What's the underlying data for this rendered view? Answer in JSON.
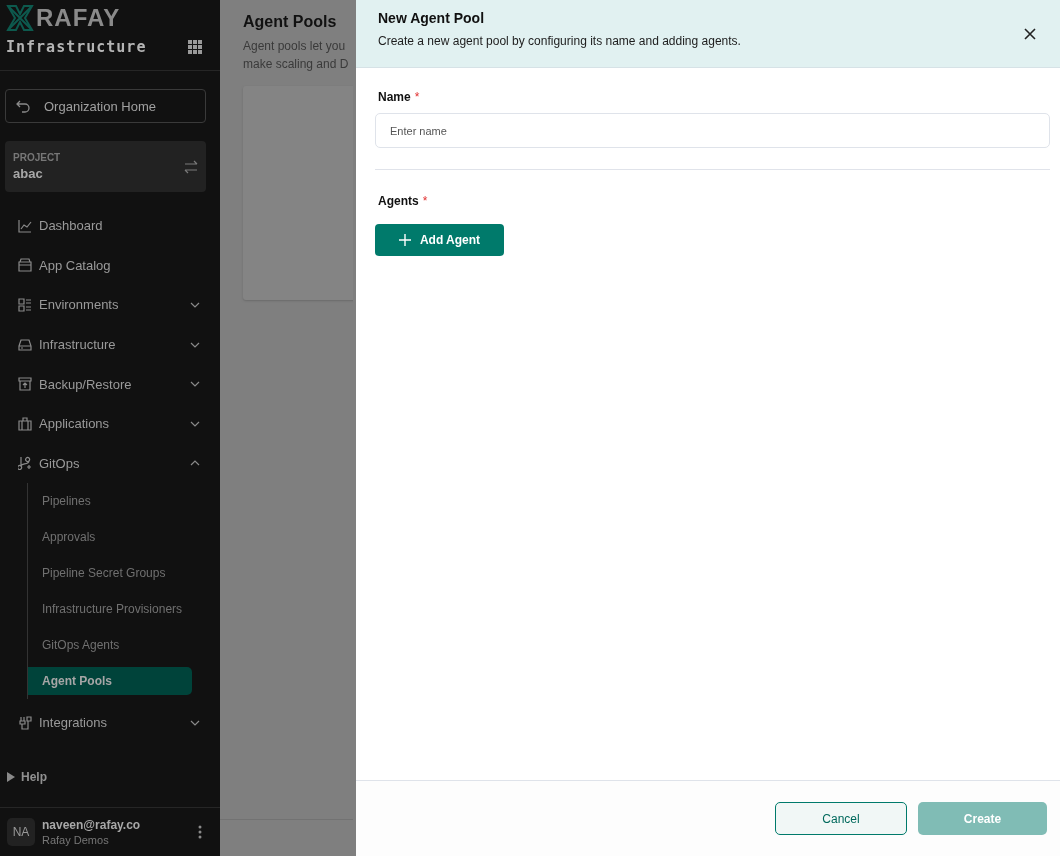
{
  "sidebar": {
    "logo": "RAFAY",
    "section": "Infrastructure",
    "home_button": "Organization Home",
    "project": {
      "label": "PROJECT",
      "value": "abac"
    },
    "items": [
      {
        "kind": "link",
        "label": "Dashboard"
      },
      {
        "kind": "link",
        "label": "App Catalog"
      },
      {
        "kind": "group",
        "label": "Environments",
        "expanded": false
      },
      {
        "kind": "group",
        "label": "Infrastructure",
        "expanded": false
      },
      {
        "kind": "group",
        "label": "Backup/Restore",
        "expanded": false
      },
      {
        "kind": "group",
        "label": "Applications",
        "expanded": false
      },
      {
        "kind": "group",
        "label": "GitOps",
        "expanded": true,
        "children": [
          {
            "label": "Pipelines",
            "selected": false
          },
          {
            "label": "Approvals",
            "selected": false
          },
          {
            "label": "Pipeline Secret Groups",
            "selected": false
          },
          {
            "label": "Infrastructure Provisioners",
            "selected": false
          },
          {
            "label": "GitOps Agents",
            "selected": false
          },
          {
            "label": "Agent Pools",
            "selected": true
          }
        ]
      },
      {
        "kind": "group",
        "label": "Integrations",
        "expanded": false
      }
    ],
    "help": "Help",
    "user": {
      "initials": "NA",
      "email": "naveen@rafay.co",
      "org": "Rafay Demos"
    }
  },
  "page": {
    "title": "Agent Pools",
    "description_lines": [
      "Agent pools let you",
      "make scaling and D"
    ]
  },
  "drawer": {
    "title": "New Agent Pool",
    "subtitle": "Create a new agent pool by configuring its name and adding agents.",
    "name_field": {
      "label": "Name",
      "required_mark": "*",
      "placeholder": "Enter name"
    },
    "agents": {
      "label": "Agents",
      "required_mark": "*",
      "button": "Add Agent"
    },
    "buttons": [
      {
        "kind": "secondary",
        "label": "Cancel",
        "disabled": false
      },
      {
        "kind": "primary",
        "label": "Create",
        "disabled": true
      }
    ]
  }
}
